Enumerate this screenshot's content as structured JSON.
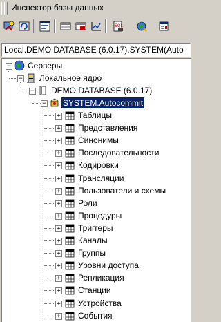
{
  "window": {
    "title": "Инспектор базы данных"
  },
  "toolbar": {
    "buttons": [
      {
        "icon": "connect-icon"
      },
      {
        "icon": "refresh-icon"
      },
      {
        "icon": "sql-editor-icon"
      },
      {
        "icon": "table-view-icon"
      },
      {
        "icon": "procedure-icon"
      },
      {
        "icon": "chart-icon"
      },
      {
        "icon": "script-icon"
      },
      {
        "icon": "globe-tool-icon"
      },
      {
        "icon": "properties-icon"
      }
    ]
  },
  "address": {
    "value": "Local.DEMO DATABASE (6.0.17).SYSTEM(Auto"
  },
  "tree": {
    "servers": "Серверы",
    "local_core": "Локальное ядро",
    "database": "DEMO DATABASE (6.0.17)",
    "connection": "SYSTEM.Autocommit",
    "folders": [
      "Таблицы",
      "Представления",
      "Синонимы",
      "Последовательности",
      "Кодировки",
      "Трансляции",
      "Пользователи и схемы",
      "Роли",
      "Процедуры",
      "Триггеры",
      "Каналы",
      "Группы",
      "Уровни доступа",
      "Репликация",
      "Станции",
      "Устройства",
      "События"
    ]
  },
  "colors": {
    "selection": "#0a246a",
    "face": "#d4d0c8"
  }
}
